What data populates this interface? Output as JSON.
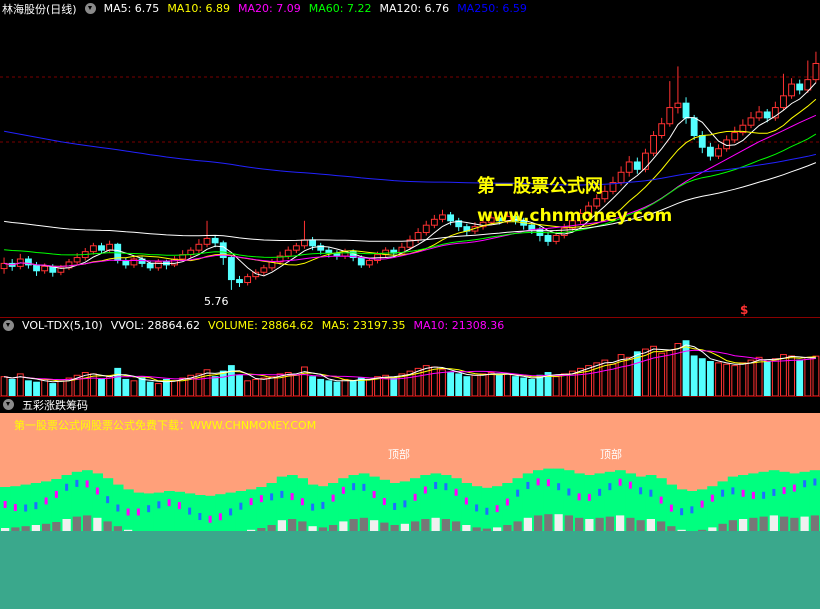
{
  "header": {
    "stock_title": "林海股份(日线)",
    "indicators": [
      {
        "label": "MA5: 6.75",
        "color": "#ffffff"
      },
      {
        "label": "MA10: 6.89",
        "color": "#ffff00"
      },
      {
        "label": "MA20: 7.09",
        "color": "#ff00ff"
      },
      {
        "label": "MA60: 7.22",
        "color": "#00ff00"
      },
      {
        "label": "MA120: 6.76",
        "color": "#ffffff"
      },
      {
        "label": "MA250: 6.59",
        "color": "#0000ff"
      }
    ]
  },
  "watermark": {
    "title": "第一股票公式网",
    "url": "www.chnmoney.com"
  },
  "price_panel": {
    "low_label": "5.76",
    "marker": "$"
  },
  "volume_panel": {
    "title": "VOL-TDX(5,10)",
    "values": [
      {
        "label": "VVOL: 28864.62",
        "color": "#ffffff"
      },
      {
        "label": "VOLUME: 28864.62",
        "color": "#ffff00"
      },
      {
        "label": "MA5: 23197.35",
        "color": "#ffff00"
      },
      {
        "label": "MA10: 21308.36",
        "color": "#ff00ff"
      }
    ]
  },
  "chip_panel": {
    "title": "五彩涨跌筹码",
    "banner": "第一股票公式网股票公式免费下载：WWW.CHNMONEY.COM",
    "top_label_1": "顶部",
    "top_label_2": "顶部"
  },
  "chart_data": [
    {
      "type": "candlestick",
      "title": "林海股份(日线)",
      "moving_averages": [
        {
          "name": "MA5",
          "value": 6.75,
          "color": "#ffffff"
        },
        {
          "name": "MA10",
          "value": 6.89,
          "color": "#ffff00"
        },
        {
          "name": "MA20",
          "value": 7.09,
          "color": "#ff00ff"
        },
        {
          "name": "MA60",
          "value": 7.22,
          "color": "#00ff00"
        },
        {
          "name": "MA120",
          "value": 6.76,
          "color": "#ffffff"
        },
        {
          "name": "MA250",
          "value": 6.59,
          "color": "#0000ff"
        }
      ],
      "annotations": [
        "5.76"
      ],
      "candles": [
        {
          "o": 6.05,
          "c": 6.12,
          "h": 6.2,
          "l": 5.98
        },
        {
          "o": 6.12,
          "c": 6.08,
          "h": 6.18,
          "l": 6.02
        },
        {
          "o": 6.08,
          "c": 6.18,
          "h": 6.25,
          "l": 6.04
        },
        {
          "o": 6.18,
          "c": 6.1,
          "h": 6.22,
          "l": 6.05
        },
        {
          "o": 6.1,
          "c": 6.02,
          "h": 6.14,
          "l": 5.95
        },
        {
          "o": 6.02,
          "c": 6.08,
          "h": 6.12,
          "l": 5.98
        },
        {
          "o": 6.08,
          "c": 6.0,
          "h": 6.11,
          "l": 5.94
        },
        {
          "o": 6.0,
          "c": 6.06,
          "h": 6.1,
          "l": 5.96
        },
        {
          "o": 6.06,
          "c": 6.14,
          "h": 6.18,
          "l": 6.03
        },
        {
          "o": 6.14,
          "c": 6.2,
          "h": 6.26,
          "l": 6.1
        },
        {
          "o": 6.2,
          "c": 6.28,
          "h": 6.33,
          "l": 6.16
        },
        {
          "o": 6.28,
          "c": 6.36,
          "h": 6.4,
          "l": 6.24
        },
        {
          "o": 6.36,
          "c": 6.3,
          "h": 6.4,
          "l": 6.25
        },
        {
          "o": 6.3,
          "c": 6.38,
          "h": 6.43,
          "l": 6.27
        },
        {
          "o": 6.38,
          "c": 6.16,
          "h": 6.4,
          "l": 6.12
        },
        {
          "o": 6.16,
          "c": 6.1,
          "h": 6.2,
          "l": 6.05
        },
        {
          "o": 6.1,
          "c": 6.18,
          "h": 6.22,
          "l": 6.06
        },
        {
          "o": 6.18,
          "c": 6.12,
          "h": 6.21,
          "l": 6.07
        },
        {
          "o": 6.12,
          "c": 6.06,
          "h": 6.15,
          "l": 6.02
        },
        {
          "o": 6.06,
          "c": 6.14,
          "h": 6.18,
          "l": 6.02
        },
        {
          "o": 6.14,
          "c": 6.1,
          "h": 6.17,
          "l": 6.04
        },
        {
          "o": 6.1,
          "c": 6.18,
          "h": 6.22,
          "l": 6.07
        },
        {
          "o": 6.18,
          "c": 6.24,
          "h": 6.3,
          "l": 6.15
        },
        {
          "o": 6.24,
          "c": 6.3,
          "h": 6.34,
          "l": 6.2
        },
        {
          "o": 6.3,
          "c": 6.38,
          "h": 6.45,
          "l": 6.26
        },
        {
          "o": 6.38,
          "c": 6.46,
          "h": 6.7,
          "l": 6.34
        },
        {
          "o": 6.46,
          "c": 6.4,
          "h": 6.5,
          "l": 6.34
        },
        {
          "o": 6.4,
          "c": 6.2,
          "h": 6.43,
          "l": 6.1
        },
        {
          "o": 6.2,
          "c": 5.9,
          "h": 6.22,
          "l": 5.76
        },
        {
          "o": 5.9,
          "c": 5.86,
          "h": 5.95,
          "l": 5.8
        },
        {
          "o": 5.86,
          "c": 5.94,
          "h": 5.98,
          "l": 5.82
        },
        {
          "o": 5.94,
          "c": 6.0,
          "h": 6.04,
          "l": 5.9
        },
        {
          "o": 6.0,
          "c": 6.06,
          "h": 6.1,
          "l": 5.96
        },
        {
          "o": 6.06,
          "c": 6.14,
          "h": 6.18,
          "l": 6.02
        },
        {
          "o": 6.14,
          "c": 6.22,
          "h": 6.28,
          "l": 6.1
        },
        {
          "o": 6.22,
          "c": 6.3,
          "h": 6.35,
          "l": 6.18
        },
        {
          "o": 6.3,
          "c": 6.36,
          "h": 6.4,
          "l": 6.26
        },
        {
          "o": 6.36,
          "c": 6.44,
          "h": 6.7,
          "l": 6.32
        },
        {
          "o": 6.44,
          "c": 6.36,
          "h": 6.48,
          "l": 6.3
        },
        {
          "o": 6.36,
          "c": 6.3,
          "h": 6.4,
          "l": 6.24
        },
        {
          "o": 6.3,
          "c": 6.26,
          "h": 6.34,
          "l": 6.2
        },
        {
          "o": 6.26,
          "c": 6.22,
          "h": 6.3,
          "l": 6.17
        },
        {
          "o": 6.22,
          "c": 6.28,
          "h": 6.32,
          "l": 6.18
        },
        {
          "o": 6.28,
          "c": 6.2,
          "h": 6.31,
          "l": 6.15
        },
        {
          "o": 6.2,
          "c": 6.1,
          "h": 6.23,
          "l": 6.06
        },
        {
          "o": 6.1,
          "c": 6.16,
          "h": 6.2,
          "l": 6.06
        },
        {
          "o": 6.16,
          "c": 6.24,
          "h": 6.28,
          "l": 6.12
        },
        {
          "o": 6.24,
          "c": 6.3,
          "h": 6.34,
          "l": 6.2
        },
        {
          "o": 6.3,
          "c": 6.26,
          "h": 6.34,
          "l": 6.21
        },
        {
          "o": 6.26,
          "c": 6.34,
          "h": 6.4,
          "l": 6.22
        },
        {
          "o": 6.34,
          "c": 6.44,
          "h": 6.5,
          "l": 6.3
        },
        {
          "o": 6.44,
          "c": 6.54,
          "h": 6.6,
          "l": 6.4
        },
        {
          "o": 6.54,
          "c": 6.64,
          "h": 6.7,
          "l": 6.5
        },
        {
          "o": 6.64,
          "c": 6.72,
          "h": 6.78,
          "l": 6.6
        },
        {
          "o": 6.72,
          "c": 6.78,
          "h": 6.85,
          "l": 6.68
        },
        {
          "o": 6.78,
          "c": 6.7,
          "h": 6.82,
          "l": 6.64
        },
        {
          "o": 6.7,
          "c": 6.62,
          "h": 6.74,
          "l": 6.56
        },
        {
          "o": 6.62,
          "c": 6.56,
          "h": 6.66,
          "l": 6.5
        },
        {
          "o": 6.56,
          "c": 6.62,
          "h": 6.68,
          "l": 6.52
        },
        {
          "o": 6.62,
          "c": 6.68,
          "h": 6.74,
          "l": 6.58
        },
        {
          "o": 6.68,
          "c": 6.74,
          "h": 6.8,
          "l": 6.64
        },
        {
          "o": 6.74,
          "c": 6.7,
          "h": 6.78,
          "l": 6.65
        },
        {
          "o": 6.7,
          "c": 6.76,
          "h": 6.82,
          "l": 6.66
        },
        {
          "o": 6.76,
          "c": 6.7,
          "h": 6.8,
          "l": 6.65
        },
        {
          "o": 6.7,
          "c": 6.64,
          "h": 6.74,
          "l": 6.58
        },
        {
          "o": 6.64,
          "c": 6.58,
          "h": 6.68,
          "l": 6.52
        },
        {
          "o": 6.58,
          "c": 6.5,
          "h": 6.62,
          "l": 6.42
        },
        {
          "o": 6.5,
          "c": 6.42,
          "h": 6.55,
          "l": 6.36
        },
        {
          "o": 6.42,
          "c": 6.5,
          "h": 6.55,
          "l": 6.38
        },
        {
          "o": 6.5,
          "c": 6.6,
          "h": 6.66,
          "l": 6.46
        },
        {
          "o": 6.6,
          "c": 6.7,
          "h": 6.76,
          "l": 6.56
        },
        {
          "o": 6.7,
          "c": 6.8,
          "h": 6.86,
          "l": 6.66
        },
        {
          "o": 6.8,
          "c": 6.9,
          "h": 6.96,
          "l": 6.76
        },
        {
          "o": 6.9,
          "c": 7.0,
          "h": 7.06,
          "l": 6.86
        },
        {
          "o": 7.0,
          "c": 7.1,
          "h": 7.18,
          "l": 6.95
        },
        {
          "o": 7.1,
          "c": 7.22,
          "h": 7.3,
          "l": 7.06
        },
        {
          "o": 7.22,
          "c": 7.36,
          "h": 7.44,
          "l": 7.18
        },
        {
          "o": 7.36,
          "c": 7.5,
          "h": 7.58,
          "l": 7.3
        },
        {
          "o": 7.5,
          "c": 7.4,
          "h": 7.56,
          "l": 7.34
        },
        {
          "o": 7.4,
          "c": 7.62,
          "h": 7.68,
          "l": 7.36
        },
        {
          "o": 7.62,
          "c": 7.86,
          "h": 7.92,
          "l": 7.58
        },
        {
          "o": 7.86,
          "c": 8.02,
          "h": 8.1,
          "l": 7.82
        },
        {
          "o": 8.02,
          "c": 8.24,
          "h": 8.6,
          "l": 7.98
        },
        {
          "o": 8.24,
          "c": 8.3,
          "h": 8.8,
          "l": 8.16
        },
        {
          "o": 8.3,
          "c": 8.1,
          "h": 8.38,
          "l": 8.02
        },
        {
          "o": 8.1,
          "c": 7.86,
          "h": 8.14,
          "l": 7.8
        },
        {
          "o": 7.86,
          "c": 7.7,
          "h": 7.92,
          "l": 7.62
        },
        {
          "o": 7.7,
          "c": 7.58,
          "h": 7.76,
          "l": 7.52
        },
        {
          "o": 7.58,
          "c": 7.68,
          "h": 7.74,
          "l": 7.54
        },
        {
          "o": 7.68,
          "c": 7.8,
          "h": 7.86,
          "l": 7.64
        },
        {
          "o": 7.8,
          "c": 7.9,
          "h": 7.98,
          "l": 7.76
        },
        {
          "o": 7.9,
          "c": 8.0,
          "h": 8.08,
          "l": 7.86
        },
        {
          "o": 8.0,
          "c": 8.1,
          "h": 8.18,
          "l": 7.96
        },
        {
          "o": 8.1,
          "c": 8.18,
          "h": 8.26,
          "l": 8.06
        },
        {
          "o": 8.18,
          "c": 8.1,
          "h": 8.22,
          "l": 8.04
        },
        {
          "o": 8.1,
          "c": 8.24,
          "h": 8.32,
          "l": 8.06
        },
        {
          "o": 8.24,
          "c": 8.4,
          "h": 8.7,
          "l": 8.2
        },
        {
          "o": 8.4,
          "c": 8.56,
          "h": 8.64,
          "l": 8.36
        },
        {
          "o": 8.56,
          "c": 8.48,
          "h": 8.62,
          "l": 8.42
        },
        {
          "o": 8.48,
          "c": 8.62,
          "h": 8.88,
          "l": 8.44
        },
        {
          "o": 8.62,
          "c": 8.84,
          "h": 9.0,
          "l": 8.58
        }
      ]
    },
    {
      "type": "bar",
      "title": "VOL-TDX(5,10)",
      "series": [
        {
          "name": "VVOL",
          "last": 28864.62
        },
        {
          "name": "VOLUME",
          "last": 28864.62
        },
        {
          "name": "MA5",
          "last": 23197.35
        },
        {
          "name": "MA10",
          "last": 21308.36
        }
      ],
      "values": [
        14000,
        12000,
        16000,
        11000,
        10000,
        12000,
        9000,
        11000,
        13000,
        15000,
        17000,
        16000,
        12000,
        14000,
        20000,
        12000,
        11000,
        13000,
        10000,
        9000,
        12000,
        11000,
        13000,
        15000,
        16000,
        19000,
        14000,
        18000,
        22000,
        15000,
        11000,
        12000,
        13000,
        14000,
        16000,
        17000,
        15000,
        21000,
        14000,
        12000,
        11000,
        10000,
        12000,
        11000,
        13000,
        12000,
        14000,
        15000,
        13000,
        16000,
        18000,
        20000,
        22000,
        21000,
        19000,
        17000,
        16000,
        14000,
        15000,
        16000,
        17000,
        15000,
        16000,
        14000,
        13000,
        12000,
        15000,
        17000,
        14000,
        16000,
        18000,
        20000,
        22000,
        24000,
        26000,
        23000,
        30000,
        28000,
        32000,
        34000,
        36000,
        31000,
        33000,
        38000,
        40000,
        29000,
        27000,
        25000,
        24000,
        23000,
        22000,
        24000,
        26000,
        28000,
        25000,
        27000,
        30000,
        29000,
        26000,
        28000,
        28864.62
      ]
    },
    {
      "type": "area",
      "title": "五彩涨跌筹码",
      "annotations": [
        "顶部",
        "顶部"
      ],
      "green_profile": [
        0.55,
        0.56,
        0.58,
        0.6,
        0.62,
        0.65,
        0.7,
        0.74,
        0.76,
        0.72,
        0.66,
        0.58,
        0.52,
        0.48,
        0.47,
        0.48,
        0.5,
        0.49,
        0.47,
        0.45,
        0.44,
        0.46,
        0.48,
        0.5,
        0.52,
        0.55,
        0.6,
        0.68,
        0.7,
        0.66,
        0.58,
        0.56,
        0.6,
        0.66,
        0.7,
        0.72,
        0.68,
        0.64,
        0.6,
        0.62,
        0.66,
        0.7,
        0.72,
        0.7,
        0.66,
        0.6,
        0.56,
        0.54,
        0.56,
        0.6,
        0.66,
        0.72,
        0.76,
        0.78,
        0.78,
        0.76,
        0.72,
        0.7,
        0.72,
        0.74,
        0.76,
        0.72,
        0.68,
        0.7,
        0.66,
        0.58,
        0.52,
        0.5,
        0.52,
        0.56,
        0.62,
        0.68,
        0.7,
        0.72,
        0.74,
        0.76,
        0.74,
        0.72,
        0.74,
        0.76
      ]
    }
  ]
}
